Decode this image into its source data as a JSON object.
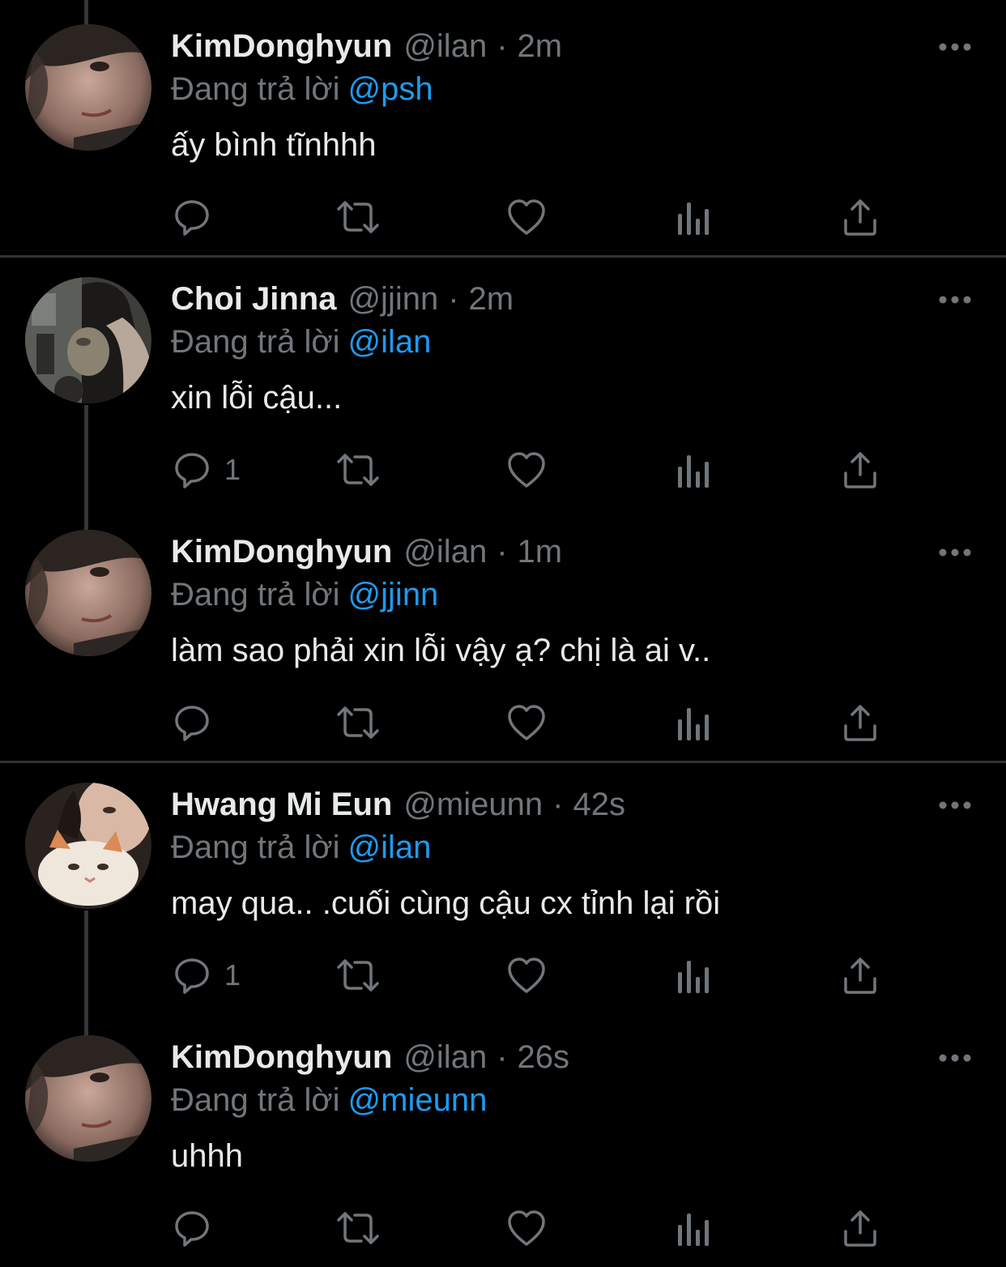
{
  "colors": {
    "background": "#000000",
    "text": "#e7e9ea",
    "muted": "#71767b",
    "link": "#1d9bf0",
    "divider": "#2f3336"
  },
  "reply_prefix": "Đang trả lời",
  "tweets": [
    {
      "name": "KimDonghyun",
      "handle": "@ilan",
      "sep": "·",
      "time": "2m",
      "reply_to": "@psh",
      "text": "ấy bình tĩnhhh",
      "reply_count": "",
      "avatar": "kimdonghyun-avatar"
    },
    {
      "name": "Choi Jinna",
      "handle": "@jjinn",
      "sep": "·",
      "time": "2m",
      "reply_to": "@ilan",
      "text": "xin lỗi cậu...",
      "reply_count": "1",
      "avatar": "choi-jinna-avatar"
    },
    {
      "name": "KimDonghyun",
      "handle": "@ilan",
      "sep": "·",
      "time": "1m",
      "reply_to": "@jjinn",
      "text": "làm sao phải xin lỗi vậy ạ? chị là ai v..",
      "reply_count": "",
      "avatar": "kimdonghyun-avatar"
    },
    {
      "name": "Hwang Mi Eun",
      "handle": "@mieunn",
      "sep": "·",
      "time": "42s",
      "reply_to": "@ilan",
      "text": "may qua.. .cuối cùng cậu cx tỉnh lại rồi",
      "reply_count": "1",
      "avatar": "hwang-mi-eun-avatar"
    },
    {
      "name": "KimDonghyun",
      "handle": "@ilan",
      "sep": "·",
      "time": "26s",
      "reply_to": "@mieunn",
      "text": "uhhh",
      "reply_count": "",
      "avatar": "kimdonghyun-avatar"
    }
  ],
  "action_icons": [
    "reply-icon",
    "retweet-icon",
    "like-icon",
    "analytics-icon",
    "share-icon"
  ]
}
